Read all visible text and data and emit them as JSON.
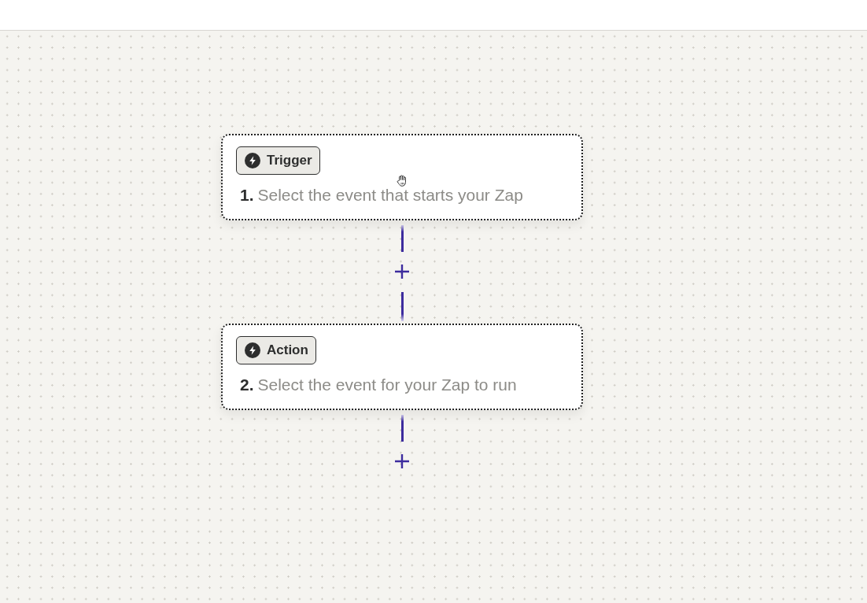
{
  "steps": [
    {
      "badge": "Trigger",
      "number": "1.",
      "prompt": "Select the event that starts your Zap"
    },
    {
      "badge": "Action",
      "number": "2.",
      "prompt": "Select the event for your Zap to run"
    }
  ]
}
